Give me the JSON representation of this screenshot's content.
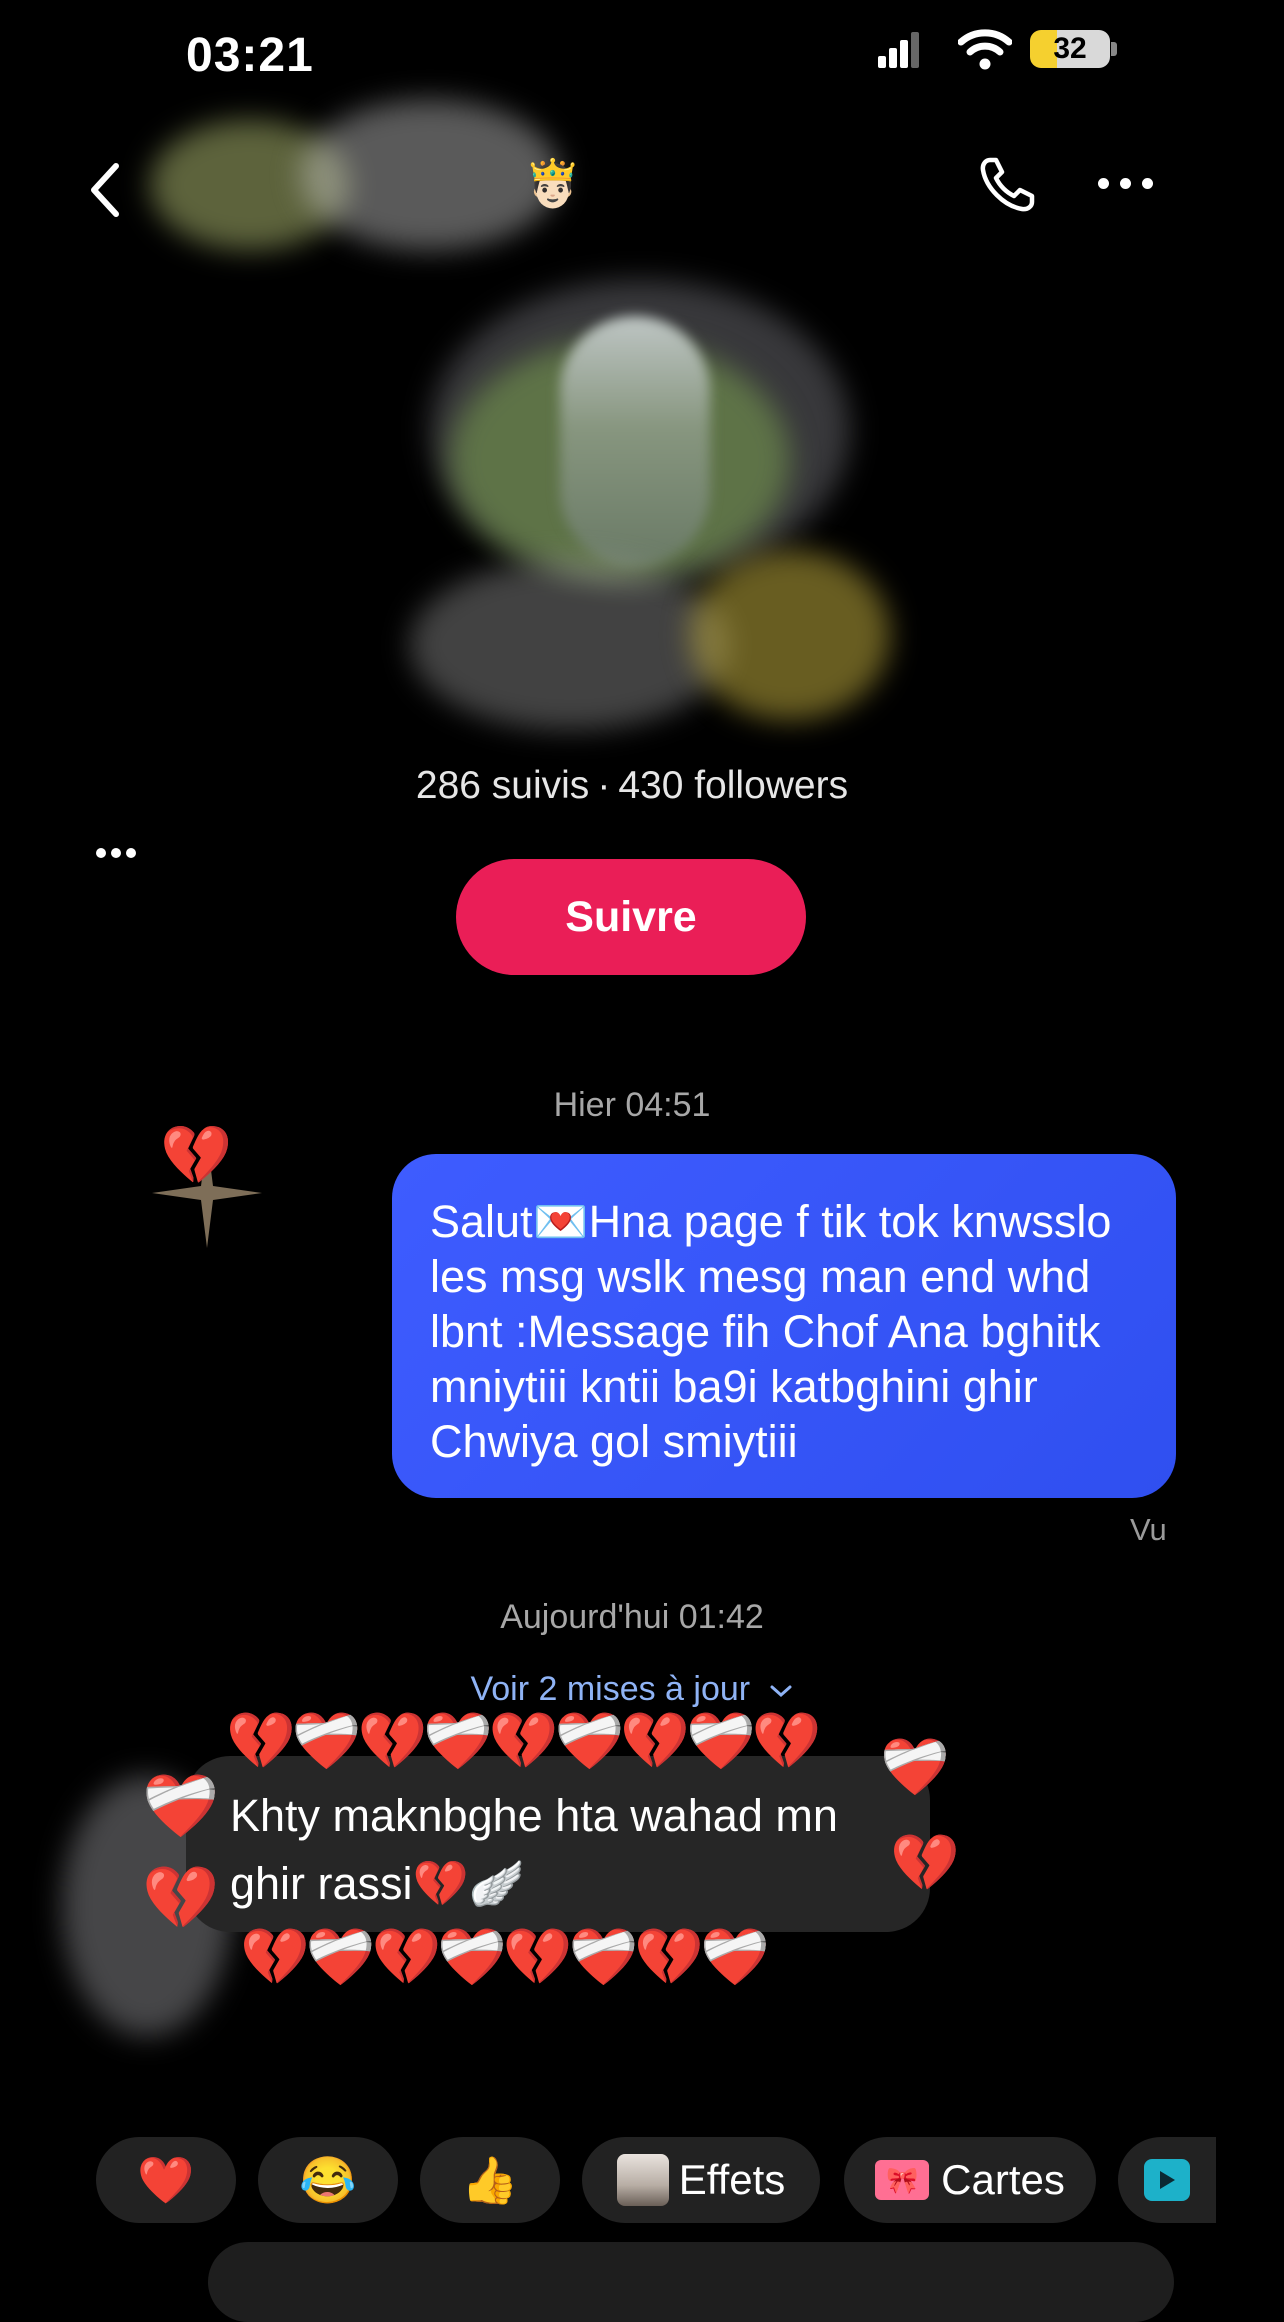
{
  "status_bar": {
    "time": "03:21",
    "battery": "32"
  },
  "header": {
    "crown_emoji": "🤴🏻",
    "back_icon": "chevron-left-icon",
    "call_icon": "phone-icon",
    "more_icon": "more-horizontal-icon"
  },
  "profile": {
    "following": "286 suivis",
    "separator": "·",
    "followers": "430 followers",
    "follow_label": "Suivre",
    "follow_color": "#ea1e57"
  },
  "chat": {
    "timestamp_1": "Hier 04:51",
    "sent_message": "Salut💌Hna page f tik tok knwsslo les msg wslk mesg man end whd lbnt :Message fih Chof Ana bghitk mniytiii kntii ba9i katbghini ghir Chwiya gol smiytiii",
    "sent_color": "#3552f7",
    "seen_label": "Vu",
    "timestamp_2": "Aujourd'hui 01:42",
    "updates_link": "Voir 2 mises à jour",
    "received_message": "Khty maknbghe hta wahad mn ghir rassi💔🪽",
    "reaction_emoji": "💔"
  },
  "quick_actions": {
    "heart": "❤️",
    "laugh": "😂",
    "thumbs_up": "👍",
    "effects_label": "Effets",
    "cards_label": "Cartes",
    "cards_icon": "🎀"
  },
  "hearts": {
    "top_row": "💔❤️‍🩹💔❤️‍🩹💔❤️‍🩹💔❤️‍🩹💔",
    "bottom_row": "💔❤️‍🩹💔❤️‍🩹💔❤️‍🩹💔❤️‍🩹",
    "mending": "❤️‍🩹",
    "broken": "💔"
  }
}
